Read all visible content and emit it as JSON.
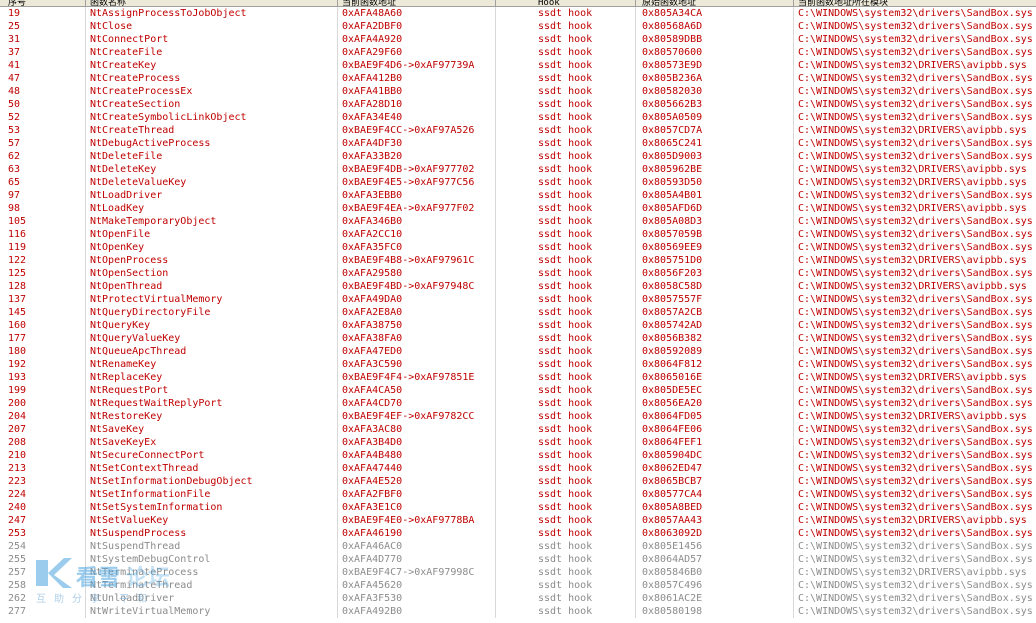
{
  "columns": [
    "序号",
    "函数名称",
    "当前函数地址",
    "Hook",
    "原始函数地址",
    "当前函数地址所在模块"
  ],
  "rows": [
    {
      "idx": "19",
      "name": "NtAssignProcessToJobObject",
      "cur": "0xAFA48A60",
      "type": "ssdt hook",
      "orig": "0x805A34CA",
      "module": "C:\\WINDOWS\\system32\\drivers\\SandBox.sys"
    },
    {
      "idx": "25",
      "name": "NtClose",
      "cur": "0xAFA2DBF0",
      "type": "ssdt hook",
      "orig": "0x80568A6D",
      "module": "C:\\WINDOWS\\system32\\drivers\\SandBox.sys"
    },
    {
      "idx": "31",
      "name": "NtConnectPort",
      "cur": "0xAFA4A920",
      "type": "ssdt hook",
      "orig": "0x80589DBB",
      "module": "C:\\WINDOWS\\system32\\drivers\\SandBox.sys"
    },
    {
      "idx": "37",
      "name": "NtCreateFile",
      "cur": "0xAFA29F60",
      "type": "ssdt hook",
      "orig": "0x80570600",
      "module": "C:\\WINDOWS\\system32\\drivers\\SandBox.sys"
    },
    {
      "idx": "41",
      "name": "NtCreateKey",
      "cur": "0xBAE9F4D6->0xAF97739A",
      "type": "ssdt hook",
      "orig": "0x80573E9D",
      "module": "C:\\WINDOWS\\system32\\DRIVERS\\avipbb.sys"
    },
    {
      "idx": "47",
      "name": "NtCreateProcess",
      "cur": "0xAFA412B0",
      "type": "ssdt hook",
      "orig": "0x805B236A",
      "module": "C:\\WINDOWS\\system32\\drivers\\SandBox.sys"
    },
    {
      "idx": "48",
      "name": "NtCreateProcessEx",
      "cur": "0xAFA41BB0",
      "type": "ssdt hook",
      "orig": "0x80582030",
      "module": "C:\\WINDOWS\\system32\\drivers\\SandBox.sys"
    },
    {
      "idx": "50",
      "name": "NtCreateSection",
      "cur": "0xAFA28D10",
      "type": "ssdt hook",
      "orig": "0x805662B3",
      "module": "C:\\WINDOWS\\system32\\drivers\\SandBox.sys"
    },
    {
      "idx": "52",
      "name": "NtCreateSymbolicLinkObject",
      "cur": "0xAFA34E40",
      "type": "ssdt hook",
      "orig": "0x805A0509",
      "module": "C:\\WINDOWS\\system32\\drivers\\SandBox.sys"
    },
    {
      "idx": "53",
      "name": "NtCreateThread",
      "cur": "0xBAE9F4CC->0xAF97A526",
      "type": "ssdt hook",
      "orig": "0x8057CD7A",
      "module": "C:\\WINDOWS\\system32\\DRIVERS\\avipbb.sys"
    },
    {
      "idx": "57",
      "name": "NtDebugActiveProcess",
      "cur": "0xAFA4DF30",
      "type": "ssdt hook",
      "orig": "0x8065C241",
      "module": "C:\\WINDOWS\\system32\\drivers\\SandBox.sys"
    },
    {
      "idx": "62",
      "name": "NtDeleteFile",
      "cur": "0xAFA33B20",
      "type": "ssdt hook",
      "orig": "0x805D9003",
      "module": "C:\\WINDOWS\\system32\\drivers\\SandBox.sys"
    },
    {
      "idx": "63",
      "name": "NtDeleteKey",
      "cur": "0xBAE9F4DB->0xAF977702",
      "type": "ssdt hook",
      "orig": "0x805962BE",
      "module": "C:\\WINDOWS\\system32\\DRIVERS\\avipbb.sys"
    },
    {
      "idx": "65",
      "name": "NtDeleteValueKey",
      "cur": "0xBAE9F4E5->0xAF977C56",
      "type": "ssdt hook",
      "orig": "0x80593D50",
      "module": "C:\\WINDOWS\\system32\\DRIVERS\\avipbb.sys"
    },
    {
      "idx": "97",
      "name": "NtLoadDriver",
      "cur": "0xAFA3EBB0",
      "type": "ssdt hook",
      "orig": "0x805A4B01",
      "module": "C:\\WINDOWS\\system32\\drivers\\SandBox.sys"
    },
    {
      "idx": "98",
      "name": "NtLoadKey",
      "cur": "0xBAE9F4EA->0xAF977F02",
      "type": "ssdt hook",
      "orig": "0x805AFD6D",
      "module": "C:\\WINDOWS\\system32\\DRIVERS\\avipbb.sys"
    },
    {
      "idx": "105",
      "name": "NtMakeTemporaryObject",
      "cur": "0xAFA346B0",
      "type": "ssdt hook",
      "orig": "0x805A08D3",
      "module": "C:\\WINDOWS\\system32\\drivers\\SandBox.sys"
    },
    {
      "idx": "116",
      "name": "NtOpenFile",
      "cur": "0xAFA2CC10",
      "type": "ssdt hook",
      "orig": "0x8057059B",
      "module": "C:\\WINDOWS\\system32\\drivers\\SandBox.sys"
    },
    {
      "idx": "119",
      "name": "NtOpenKey",
      "cur": "0xAFA35FC0",
      "type": "ssdt hook",
      "orig": "0x80569EE9",
      "module": "C:\\WINDOWS\\system32\\drivers\\SandBox.sys"
    },
    {
      "idx": "122",
      "name": "NtOpenProcess",
      "cur": "0xBAE9F4B8->0xAF97961C",
      "type": "ssdt hook",
      "orig": "0x805751D0",
      "module": "C:\\WINDOWS\\system32\\DRIVERS\\avipbb.sys"
    },
    {
      "idx": "125",
      "name": "NtOpenSection",
      "cur": "0xAFA29580",
      "type": "ssdt hook",
      "orig": "0x8056F203",
      "module": "C:\\WINDOWS\\system32\\drivers\\SandBox.sys"
    },
    {
      "idx": "128",
      "name": "NtOpenThread",
      "cur": "0xBAE9F4BD->0xAF97948C",
      "type": "ssdt hook",
      "orig": "0x8058C58D",
      "module": "C:\\WINDOWS\\system32\\DRIVERS\\avipbb.sys"
    },
    {
      "idx": "137",
      "name": "NtProtectVirtualMemory",
      "cur": "0xAFA49DA0",
      "type": "ssdt hook",
      "orig": "0x8057557F",
      "module": "C:\\WINDOWS\\system32\\drivers\\SandBox.sys"
    },
    {
      "idx": "145",
      "name": "NtQueryDirectoryFile",
      "cur": "0xAFA2E8A0",
      "type": "ssdt hook",
      "orig": "0x8057A2CB",
      "module": "C:\\WINDOWS\\system32\\drivers\\SandBox.sys"
    },
    {
      "idx": "160",
      "name": "NtQueryKey",
      "cur": "0xAFA38750",
      "type": "ssdt hook",
      "orig": "0x805742AD",
      "module": "C:\\WINDOWS\\system32\\drivers\\SandBox.sys"
    },
    {
      "idx": "177",
      "name": "NtQueryValueKey",
      "cur": "0xAFA38FA0",
      "type": "ssdt hook",
      "orig": "0x8056B382",
      "module": "C:\\WINDOWS\\system32\\drivers\\SandBox.sys"
    },
    {
      "idx": "180",
      "name": "NtQueueApcThread",
      "cur": "0xAFA47ED0",
      "type": "ssdt hook",
      "orig": "0x80592089",
      "module": "C:\\WINDOWS\\system32\\drivers\\SandBox.sys"
    },
    {
      "idx": "192",
      "name": "NtRenameKey",
      "cur": "0xAFA3C590",
      "type": "ssdt hook",
      "orig": "0x8064F812",
      "module": "C:\\WINDOWS\\system32\\drivers\\SandBox.sys"
    },
    {
      "idx": "193",
      "name": "NtReplaceKey",
      "cur": "0xBAE9F4F4->0xAF97851E",
      "type": "ssdt hook",
      "orig": "0x8065016E",
      "module": "C:\\WINDOWS\\system32\\DRIVERS\\avipbb.sys"
    },
    {
      "idx": "199",
      "name": "NtRequestPort",
      "cur": "0xAFA4CA50",
      "type": "ssdt hook",
      "orig": "0x805DE5EC",
      "module": "C:\\WINDOWS\\system32\\drivers\\SandBox.sys"
    },
    {
      "idx": "200",
      "name": "NtRequestWaitReplyPort",
      "cur": "0xAFA4CD70",
      "type": "ssdt hook",
      "orig": "0x8056EA20",
      "module": "C:\\WINDOWS\\system32\\drivers\\SandBox.sys"
    },
    {
      "idx": "204",
      "name": "NtRestoreKey",
      "cur": "0xBAE9F4EF->0xAF9782CC",
      "type": "ssdt hook",
      "orig": "0x8064FD05",
      "module": "C:\\WINDOWS\\system32\\DRIVERS\\avipbb.sys"
    },
    {
      "idx": "207",
      "name": "NtSaveKey",
      "cur": "0xAFA3AC80",
      "type": "ssdt hook",
      "orig": "0x8064FE06",
      "module": "C:\\WINDOWS\\system32\\drivers\\SandBox.sys"
    },
    {
      "idx": "208",
      "name": "NtSaveKeyEx",
      "cur": "0xAFA3B4D0",
      "type": "ssdt hook",
      "orig": "0x8064FEF1",
      "module": "C:\\WINDOWS\\system32\\drivers\\SandBox.sys"
    },
    {
      "idx": "210",
      "name": "NtSecureConnectPort",
      "cur": "0xAFA4B480",
      "type": "ssdt hook",
      "orig": "0x805904DC",
      "module": "C:\\WINDOWS\\system32\\drivers\\SandBox.sys"
    },
    {
      "idx": "213",
      "name": "NtSetContextThread",
      "cur": "0xAFA47440",
      "type": "ssdt hook",
      "orig": "0x8062ED47",
      "module": "C:\\WINDOWS\\system32\\drivers\\SandBox.sys"
    },
    {
      "idx": "223",
      "name": "NtSetInformationDebugObject",
      "cur": "0xAFA4E520",
      "type": "ssdt hook",
      "orig": "0x8065BCB7",
      "module": "C:\\WINDOWS\\system32\\drivers\\SandBox.sys"
    },
    {
      "idx": "224",
      "name": "NtSetInformationFile",
      "cur": "0xAFA2FBF0",
      "type": "ssdt hook",
      "orig": "0x80577CA4",
      "module": "C:\\WINDOWS\\system32\\drivers\\SandBox.sys"
    },
    {
      "idx": "240",
      "name": "NtSetSystemInformation",
      "cur": "0xAFA3E1C0",
      "type": "ssdt hook",
      "orig": "0x805A8BED",
      "module": "C:\\WINDOWS\\system32\\drivers\\SandBox.sys"
    },
    {
      "idx": "247",
      "name": "NtSetValueKey",
      "cur": "0xBAE9F4E0->0xAF9778BA",
      "type": "ssdt hook",
      "orig": "0x8057AA43",
      "module": "C:\\WINDOWS\\system32\\DRIVERS\\avipbb.sys"
    },
    {
      "idx": "253",
      "name": "NtSuspendProcess",
      "cur": "0xAFA46190",
      "type": "ssdt hook",
      "orig": "0x8063092D",
      "module": "C:\\WINDOWS\\system32\\drivers\\SandBox.sys"
    },
    {
      "idx": "254",
      "name": "NtSuspendThread",
      "cur": "0xAFA46AC0",
      "type": "ssdt hook",
      "orig": "0x805E1456",
      "module": "C:\\WINDOWS\\system32\\drivers\\SandBox.sys"
    },
    {
      "idx": "255",
      "name": "NtSystemDebugControl",
      "cur": "0xAFA4D770",
      "type": "ssdt hook",
      "orig": "0x8064AD57",
      "module": "C:\\WINDOWS\\system32\\drivers\\SandBox.sys"
    },
    {
      "idx": "257",
      "name": "NtTerminateProcess",
      "cur": "0xBAE9F4C7->0xAF97998C",
      "type": "ssdt hook",
      "orig": "0x805846B0",
      "module": "C:\\WINDOWS\\system32\\DRIVERS\\avipbb.sys"
    },
    {
      "idx": "258",
      "name": "NtTerminateThread",
      "cur": "0xAFA45620",
      "type": "ssdt hook",
      "orig": "0x8057C496",
      "module": "C:\\WINDOWS\\system32\\drivers\\SandBox.sys"
    },
    {
      "idx": "262",
      "name": "NtUnloadDriver",
      "cur": "0xAFA3F530",
      "type": "ssdt hook",
      "orig": "0x8061AC2E",
      "module": "C:\\WINDOWS\\system32\\drivers\\SandBox.sys"
    },
    {
      "idx": "277",
      "name": "NtWriteVirtualMemory",
      "cur": "0xAFA492B0",
      "type": "ssdt hook",
      "orig": "0x80580198",
      "module": "C:\\WINDOWS\\system32\\drivers\\SandBox.sys"
    }
  ],
  "grey_rows": [
    41,
    42,
    43,
    44,
    45,
    46
  ],
  "watermark": {
    "logo_text": "看雪",
    "logo_suffix": "论坛",
    "subtitle": "互助分享 平和"
  },
  "colors": {
    "hook_text": "#c00000",
    "faded_text": "#8c8c8c",
    "watermark": "#4aa3df"
  }
}
